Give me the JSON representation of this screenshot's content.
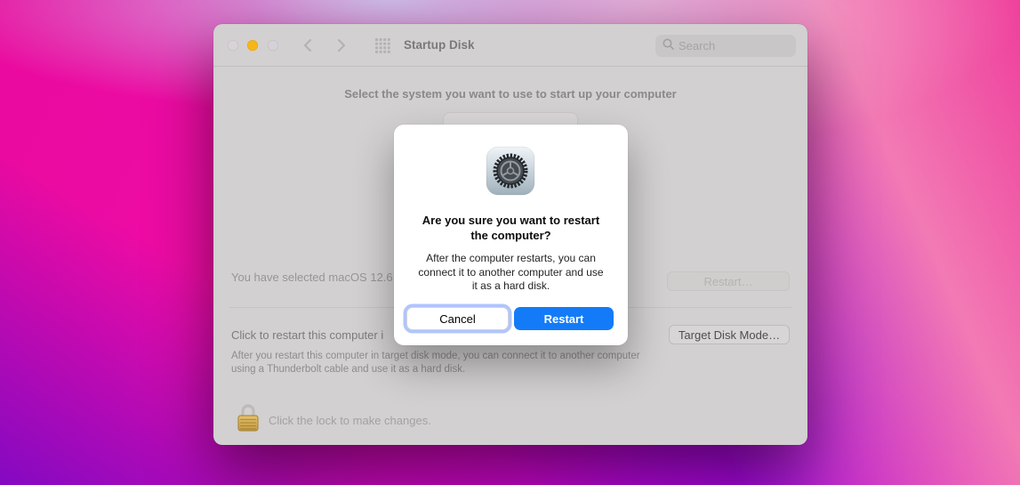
{
  "colors": {
    "accent_blue": "#147bf8",
    "traffic_yellow": "#f7b617"
  },
  "titlebar": {
    "title": "Startup Disk",
    "search_placeholder": "Search"
  },
  "content": {
    "headline": "Select the system you want to use to start up your computer",
    "selected_system_text": "You have selected macOS 12.6 on t",
    "restart_button_label": "Restart…",
    "target_disk_text": "Click to restart this computer i",
    "target_disk_mode_button_label": "Target Disk Mode…",
    "target_disk_note": "After you restart this computer in target disk mode, you can connect it to another computer\nusing a Thunderbolt cable and use it as a hard disk.",
    "lock_hint": "Click the lock to make changes."
  },
  "dialog": {
    "title": "Are you sure you want to restart\nthe computer?",
    "body": "After the computer restarts, you can\nconnect it to another computer and use\nit as a hard disk.",
    "cancel_label": "Cancel",
    "restart_label": "Restart"
  },
  "icons": [
    "close-icon",
    "minimize-icon",
    "zoom-icon",
    "back-icon",
    "forward-icon",
    "show-all-grid-icon",
    "search-icon",
    "system-preferences-gear-icon",
    "lock-icon"
  ]
}
